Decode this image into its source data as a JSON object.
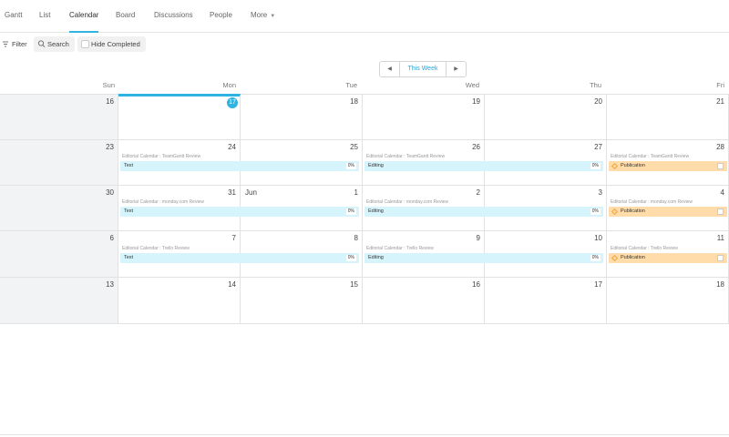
{
  "tabs": [
    {
      "label": "Gantt"
    },
    {
      "label": "List"
    },
    {
      "label": "Calendar"
    },
    {
      "label": "Board"
    },
    {
      "label": "Discussions"
    },
    {
      "label": "People"
    },
    {
      "label": "More"
    }
  ],
  "toolbar": {
    "filter_label": "Filter",
    "search_label": "Search",
    "hide_completed_label": "Hide Completed"
  },
  "week_nav": {
    "label": "This Week"
  },
  "day_headers": [
    "Sun",
    "Mon",
    "Tue",
    "Wed",
    "Thu",
    "Fri"
  ],
  "weeks": [
    {
      "days": [
        "16",
        "17",
        "18",
        "19",
        "20",
        "21"
      ]
    },
    {
      "days": [
        "23",
        "24",
        "25",
        "26",
        "27",
        "28"
      ]
    },
    {
      "days": [
        "30",
        "31",
        "1",
        "2",
        "3",
        "4"
      ],
      "month_label": "Jun"
    },
    {
      "days": [
        "6",
        "7",
        "8",
        "9",
        "10",
        "11"
      ]
    },
    {
      "days": [
        "13",
        "14",
        "15",
        "16",
        "17",
        "18"
      ]
    }
  ],
  "today": "17",
  "events": [
    {
      "project": "Editorial Calendar : TeamGantt Review",
      "task": "Text",
      "pct": "0%"
    },
    {
      "project": "Editorial Calendar : TeamGantt Review",
      "task": "Editing",
      "pct": "0%"
    },
    {
      "project": "Editorial Calendar : TeamGantt Review",
      "task": "Publication"
    },
    {
      "project": "Editorial Calendar : monday.com Review",
      "task": "Text",
      "pct": "0%"
    },
    {
      "project": "Editorial Calendar : monday.com Review",
      "task": "Editing",
      "pct": "0%"
    },
    {
      "project": "Editorial Calendar : monday.com Review",
      "task": "Publication"
    },
    {
      "project": "Editorial Calendar : Trello Review",
      "task": "Text",
      "pct": "0%"
    },
    {
      "project": "Editorial Calendar : Trello Review",
      "task": "Editing",
      "pct": "0%"
    },
    {
      "project": "Editorial Calendar : Trello Review",
      "task": "Publication"
    }
  ],
  "colors": {
    "accent": "#2fb3e0",
    "task_bar": "#d5f4fb",
    "milestone_bar": "#ffdcaa"
  }
}
